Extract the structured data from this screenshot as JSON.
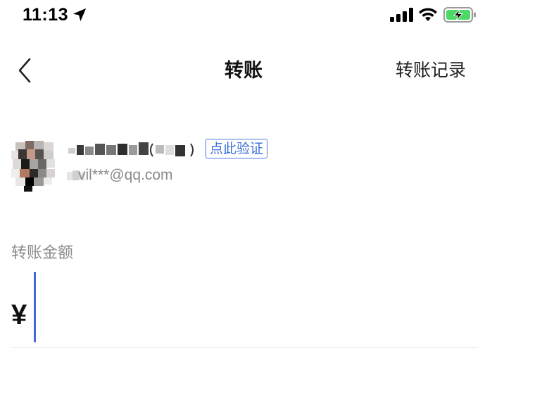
{
  "status_bar": {
    "time": "11:13",
    "icons": [
      "location-arrow-icon",
      "signal-icon",
      "wifi-icon",
      "battery-charging-icon"
    ],
    "battery_color": "#4cd964"
  },
  "nav": {
    "back_icon": "chevron-left-icon",
    "title": "转账",
    "action_label": "转账记录"
  },
  "recipient": {
    "name": "",
    "verify_label": "点此验证",
    "account": "vil***@qq.com",
    "account_visible": "***@qq.com"
  },
  "amount": {
    "label": "转账金额",
    "currency_symbol": "¥",
    "value": ""
  },
  "colors": {
    "accent": "#4169e1",
    "badge": "#3b6fd8",
    "muted_text": "#8c8c8c"
  }
}
